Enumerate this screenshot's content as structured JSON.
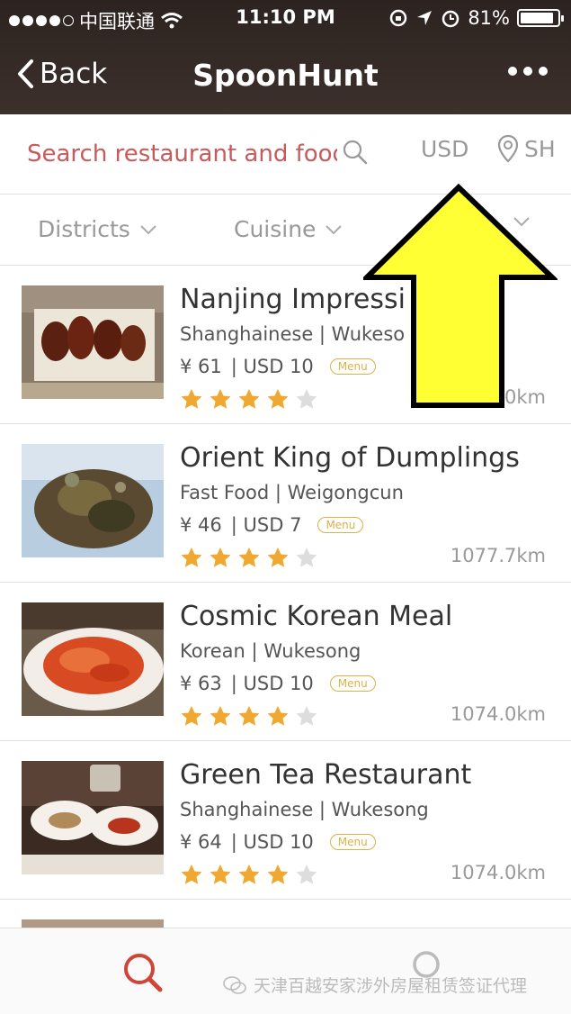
{
  "status_bar": {
    "carrier": "中国联通",
    "time": "11:10 PM",
    "battery": "81%"
  },
  "nav": {
    "back_label": "Back",
    "title": "SpoonHunt"
  },
  "search": {
    "placeholder": "Search restaurant and food...",
    "currency": "USD",
    "city": "SH"
  },
  "filters": [
    {
      "label": "Districts"
    },
    {
      "label": "Cuisine"
    }
  ],
  "restaurants": [
    {
      "name": "Nanjing Impressi    o...",
      "meta": "Shanghainese | Wukeso",
      "price_cny": "¥ 61",
      "price_usd": "| USD 10",
      "menu": "Menu",
      "rating": 4,
      "distance": "0km"
    },
    {
      "name": "Orient King of Dumplings",
      "meta": "Fast Food | Weigongcun",
      "price_cny": "¥ 46",
      "price_usd": "| USD 7",
      "menu": "Menu",
      "rating": 4,
      "distance": "1077.7km"
    },
    {
      "name": "Cosmic Korean Meal",
      "meta": "Korean | Wukesong",
      "price_cny": "¥ 63",
      "price_usd": "| USD 10",
      "menu": "Menu",
      "rating": 4,
      "distance": "1074.0km"
    },
    {
      "name": "Green Tea Restaurant",
      "meta": "Shanghainese | Wukesong",
      "price_cny": "¥ 64",
      "price_usd": "| USD 10",
      "menu": "Menu",
      "rating": 4,
      "distance": "1074.0km"
    }
  ],
  "watermark": "天津百越安家涉外房屋租赁签证代理",
  "colors": {
    "accent": "#c75a5a",
    "star_on": "#f0a830",
    "star_off": "#dddddd",
    "menu_badge": "#d8b24a",
    "arrow_fill": "#ffff33"
  },
  "icons": {
    "search_tab": "search-icon",
    "profile_tab": "user-icon",
    "location": "location-pin-icon",
    "back": "chevron-left-icon",
    "more": "more-dots-icon"
  }
}
